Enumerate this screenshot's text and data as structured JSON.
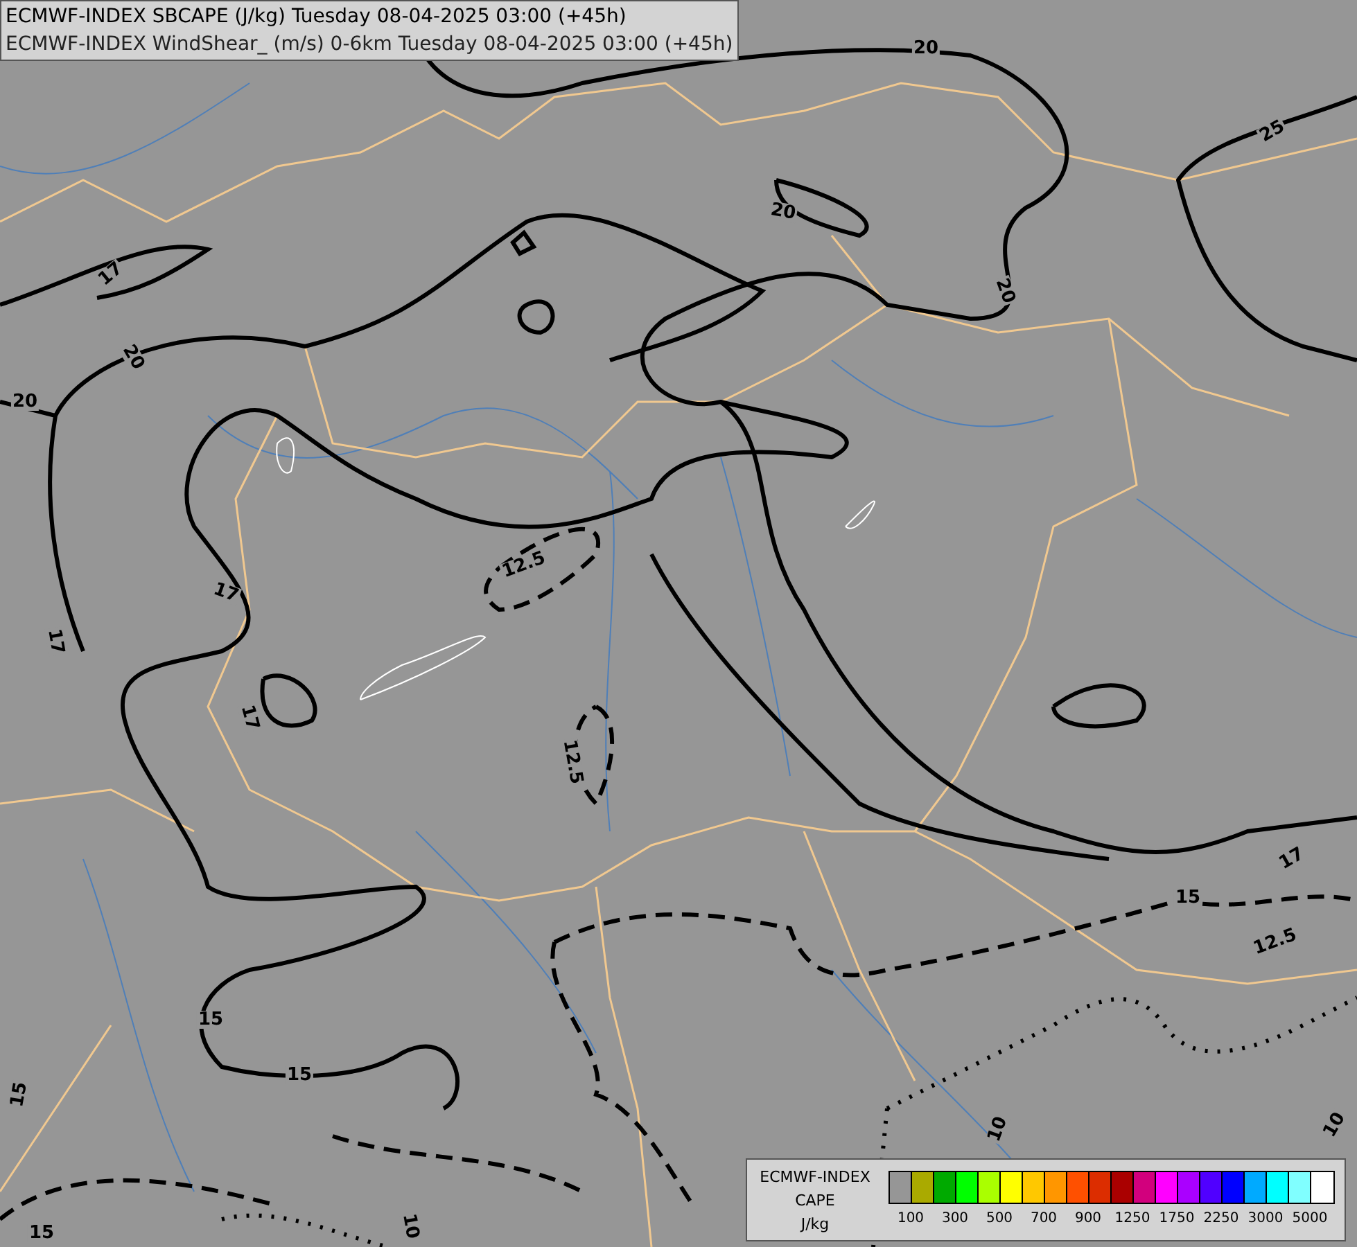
{
  "titles": [
    "ECMWF-INDEX SBCAPE (J/kg) Tuesday 08-04-2025 03:00 (+45h)",
    "ECMWF-INDEX WindShear_ (m/s) 0-6km Tuesday 08-04-2025 03:00 (+45h)"
  ],
  "contour_labels": [
    "20",
    "25",
    "20",
    "20",
    "17",
    "20",
    "20",
    "17",
    "17",
    "17",
    "12.5",
    "12.5",
    "17",
    "15",
    "12.5",
    "15",
    "15",
    "15",
    "10",
    "15",
    "10",
    "10"
  ],
  "legend": {
    "title": [
      "ECMWF-INDEX",
      "CAPE",
      "J/kg"
    ],
    "swatches": [
      {
        "color": "#969696"
      },
      {
        "color": "#aaaa00"
      },
      {
        "color": "#00aa00"
      },
      {
        "color": "#00ff00"
      },
      {
        "color": "#aaff00"
      },
      {
        "color": "#ffff00"
      },
      {
        "color": "#ffc800"
      },
      {
        "color": "#ff9600"
      },
      {
        "color": "#ff5000"
      },
      {
        "color": "#dc2d00"
      },
      {
        "color": "#aa0000"
      },
      {
        "color": "#d2007d"
      },
      {
        "color": "#ff00ff"
      },
      {
        "color": "#aa00ff"
      },
      {
        "color": "#5000ff"
      },
      {
        "color": "#0000ff"
      },
      {
        "color": "#00aaff"
      },
      {
        "color": "#00ffff"
      },
      {
        "color": "#80ffff"
      },
      {
        "color": "#ffffff"
      }
    ],
    "tick_labels": [
      "100",
      "300",
      "500",
      "700",
      "900",
      "1250",
      "1750",
      "2250",
      "3000",
      "5000"
    ]
  }
}
